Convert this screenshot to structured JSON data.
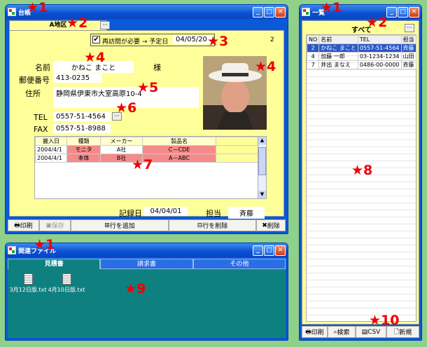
{
  "ledger": {
    "title": "台帳",
    "tab_label": "A地区",
    "revisit_label": "再訪問が必要 → 予定日",
    "revisit_checked": true,
    "scheduled_date": "04/05/20",
    "record_count": "2",
    "name_label": "名前",
    "name_value": "かねこ まこと",
    "honorific": "様",
    "zip_label": "郵便番号",
    "zip_value": "413-0235",
    "address_label": "住所",
    "address_value": "静岡県伊東市大室高原10-4",
    "tel_label": "TEL",
    "tel_value": "0557-51-4564",
    "fax_label": "FAX",
    "fax_value": "0557-51-8988",
    "table_headers": [
      "搬入日",
      "種類",
      "メーカー",
      "製品名"
    ],
    "table_rows": [
      [
        "2004/4/1",
        "モニタ",
        "A社",
        "C－CDE"
      ],
      [
        "2004/4/1",
        "本体",
        "B社",
        "A－ABC"
      ]
    ],
    "record_date_label": "記録日",
    "record_date_value": "04/04/01",
    "staff_label": "担当",
    "staff_value": "斉藤",
    "toolbar": {
      "print": "印刷",
      "save": "保存",
      "add_row": "行を追加",
      "delete_row": "行を削除",
      "delete": "削除"
    }
  },
  "list": {
    "title": "一覧",
    "filter_label": "すべて",
    "headers": [
      "NO",
      "名前",
      "TEL",
      "担当"
    ],
    "rows": [
      [
        "2",
        "かねこ まこと",
        "0557-51-4564",
        "斉藤"
      ],
      [
        "4",
        "加藤 一郎",
        "03-1234-1234",
        "山田"
      ],
      [
        "7",
        "井出 まなえ",
        "0486-00-0000",
        "斉藤"
      ]
    ],
    "toolbar": {
      "print": "印刷",
      "search": "検索",
      "csv": "CSV",
      "new": "新規"
    }
  },
  "related": {
    "title": "関連ファイル",
    "tabs": [
      "見積書",
      "請求書",
      "その他"
    ],
    "files": [
      "3月12日版.txt",
      "4月10日版.txt"
    ]
  },
  "stars": {
    "s1a": "★1",
    "s1b": "★1",
    "s1c": "★1",
    "s2a": "★2",
    "s2b": "★2",
    "s3": "★3",
    "s4a": "★4",
    "s4b": "★4",
    "s5": "★5",
    "s6": "★6",
    "s7": "★7",
    "s8": "★8",
    "s9": "★9",
    "s10": "★10"
  },
  "colors": {
    "desktop": "#8fd08a",
    "window_blue": "#0a59d6",
    "form_yellow": "#ffff99",
    "highlight_pink": "#f58a8a",
    "files_teal": "#0f8080",
    "star_red": "#e00000"
  }
}
